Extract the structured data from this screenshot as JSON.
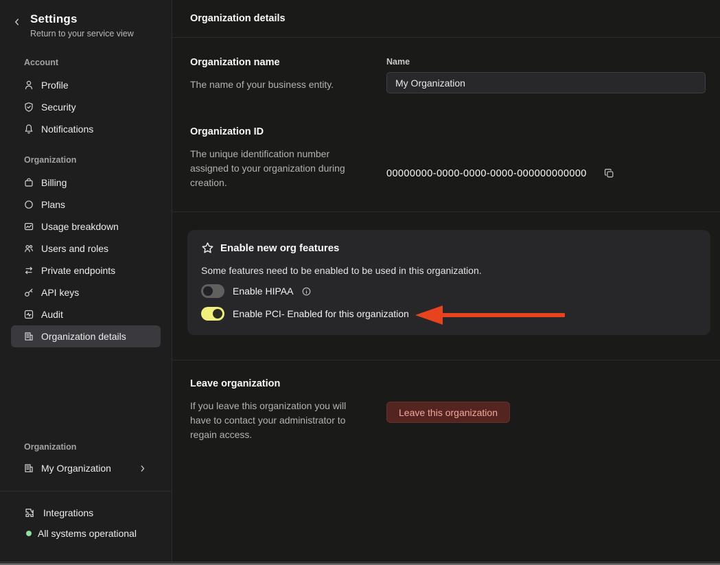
{
  "colors": {
    "toggle_on_yellow": "#f3ef7d",
    "annotation_arrow_red": "#e8431f",
    "status_green": "#8ee2a1",
    "danger_button_bg": "#542520",
    "danger_button_text": "#f2a79e",
    "selected_item_bg": "#3a3a3e"
  },
  "sidebar": {
    "back_icon": "chevron-left-icon",
    "title": "Settings",
    "subtitle": "Return to your service view",
    "account_label": "Account",
    "account_items": [
      {
        "label": "Profile",
        "icon": "person-icon"
      },
      {
        "label": "Security",
        "icon": "shield-icon"
      },
      {
        "label": "Notifications",
        "icon": "bell-icon"
      }
    ],
    "organization_label": "Organization",
    "organization_items": [
      {
        "label": "Billing",
        "icon": "wallet-icon"
      },
      {
        "label": "Plans",
        "icon": "circle-icon"
      },
      {
        "label": "Usage breakdown",
        "icon": "chart-image-icon"
      },
      {
        "label": "Users and roles",
        "icon": "users-icon"
      },
      {
        "label": "Private endpoints",
        "icon": "swap-arrows-icon"
      },
      {
        "label": "API keys",
        "icon": "key-icon"
      },
      {
        "label": "Audit",
        "icon": "audit-icon"
      },
      {
        "label": "Organization details",
        "icon": "building-icon",
        "selected": true
      }
    ],
    "switcher_label": "Organization",
    "switcher": {
      "label": "My Organization",
      "icon": "building-icon",
      "chevron": "chevron-right-icon"
    },
    "footer": {
      "integrations_label": "Integrations",
      "integrations_icon": "puzzle-icon",
      "status_label": "All systems operational",
      "status_icon": "status-dot"
    }
  },
  "main": {
    "header_title": "Organization details",
    "org_name": {
      "title": "Organization name",
      "description": "The name of your business entity.",
      "field_label": "Name",
      "field_value": "My Organization"
    },
    "org_id": {
      "title": "Organization ID",
      "description": "The unique identification number assigned to your organization during creation.",
      "value": "00000000-0000-0000-0000-000000000000",
      "copy_icon": "copy-icon"
    },
    "features": {
      "icon": "star-icon",
      "title": "Enable new org features",
      "description": "Some features need to be enabled to be used in this organization.",
      "toggles": [
        {
          "label": "Enable HIPAA",
          "state": "off",
          "info_icon": "info-icon"
        },
        {
          "label": "Enable PCI- Enabled for this organization",
          "state": "on"
        }
      ]
    },
    "leave": {
      "title": "Leave organization",
      "description": "If you leave this organization you will have to contact your administrator to regain access.",
      "button_label": "Leave this organization"
    }
  }
}
